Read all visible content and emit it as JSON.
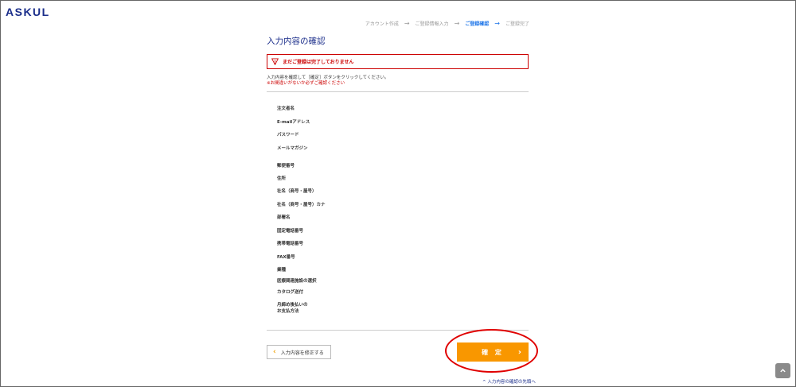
{
  "brand": {
    "logo_text": "ASKUL",
    "logo_color": "#1a2d8a"
  },
  "steps": [
    {
      "label": "アカウント作成",
      "active": false
    },
    {
      "label": "ご登録情報入力",
      "active": false
    },
    {
      "label": "ご登録確認",
      "active": true
    },
    {
      "label": "ご登録完了",
      "active": false
    }
  ],
  "page": {
    "title": "入力内容の確認",
    "alert": "まだご登録は完了しておりません",
    "desc_line1": "入力内容を確認して［確定］ボタンをクリックしてください。",
    "desc_line2": "※お間違いがないか必ずご確認ください"
  },
  "fields": [
    "注文者名",
    "E-mailアドレス",
    "パスワード",
    "メールマガジン",
    "郵便番号",
    "住所",
    "社名（商号・屋号）",
    "社名（商号・屋号）カナ",
    "部署名",
    "固定電話番号",
    "携帯電話番号",
    "FAX番号",
    "業種",
    "医療関連施設の選択",
    "カタログ送付",
    "月締め後払いの",
    "お支払方法"
  ],
  "buttons": {
    "back_label": "入力内容を修正する",
    "confirm_label": "確 定"
  },
  "links": {
    "top_label": "^ 入力内容の確認の先頭へ"
  },
  "icons": {
    "alert": "warning-triangle-icon",
    "back": "chevron-left-icon",
    "confirm": "chevron-right-icon",
    "scroll": "chevron-up-icon"
  },
  "colors": {
    "accent": "#f99700",
    "alert": "#cc0000",
    "step_active": "#1a73e8",
    "annotation_circle": "#e00000"
  }
}
